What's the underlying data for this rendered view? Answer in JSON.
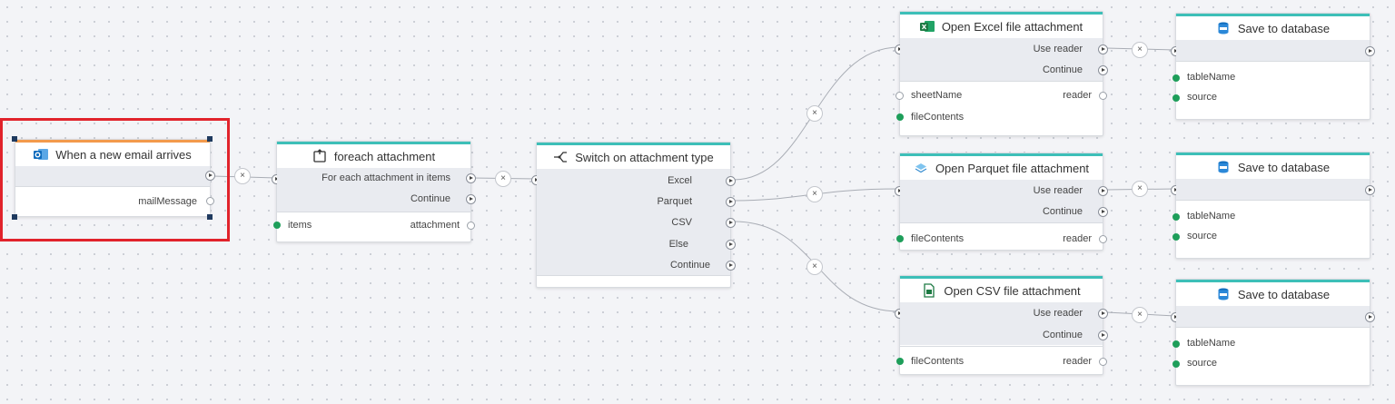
{
  "trigger": {
    "title": "When a new email arrives",
    "outputs": [
      "mailMessage"
    ]
  },
  "foreach": {
    "title": "foreach attachment",
    "flow": [
      "For each attachment in items",
      "Continue"
    ],
    "input": "items",
    "output": "attachment"
  },
  "switch": {
    "title": "Switch on attachment type",
    "cases": [
      "Excel",
      "Parquet",
      "CSV",
      "Else",
      "Continue"
    ]
  },
  "excel": {
    "title": "Open Excel file attachment",
    "flow": [
      "Use reader",
      "Continue"
    ],
    "inputs": [
      "sheetName",
      "fileContents"
    ],
    "output": "reader"
  },
  "parquet": {
    "title": "Open Parquet file attachment",
    "flow": [
      "Use reader",
      "Continue"
    ],
    "inputs": [
      "fileContents"
    ],
    "output": "reader"
  },
  "csv": {
    "title": "Open CSV file attachment",
    "flow": [
      "Use reader",
      "Continue"
    ],
    "inputs": [
      "fileContents"
    ],
    "output": "reader"
  },
  "save1": {
    "title": "Save to database",
    "inputs": [
      "tableName",
      "source"
    ]
  },
  "save2": {
    "title": "Save to database",
    "inputs": [
      "tableName",
      "source"
    ]
  },
  "save3": {
    "title": "Save to database",
    "inputs": [
      "tableName",
      "source"
    ]
  },
  "connector_symbol": "×",
  "colors": {
    "accent_teal": "#3dbfb8",
    "trigger_orange": "#f39a4b",
    "selection_red": "#e1232b",
    "data_port_green": "#1e9e5a",
    "outlook_blue": "#0f6cbd",
    "excel_green": "#1d7a43"
  }
}
